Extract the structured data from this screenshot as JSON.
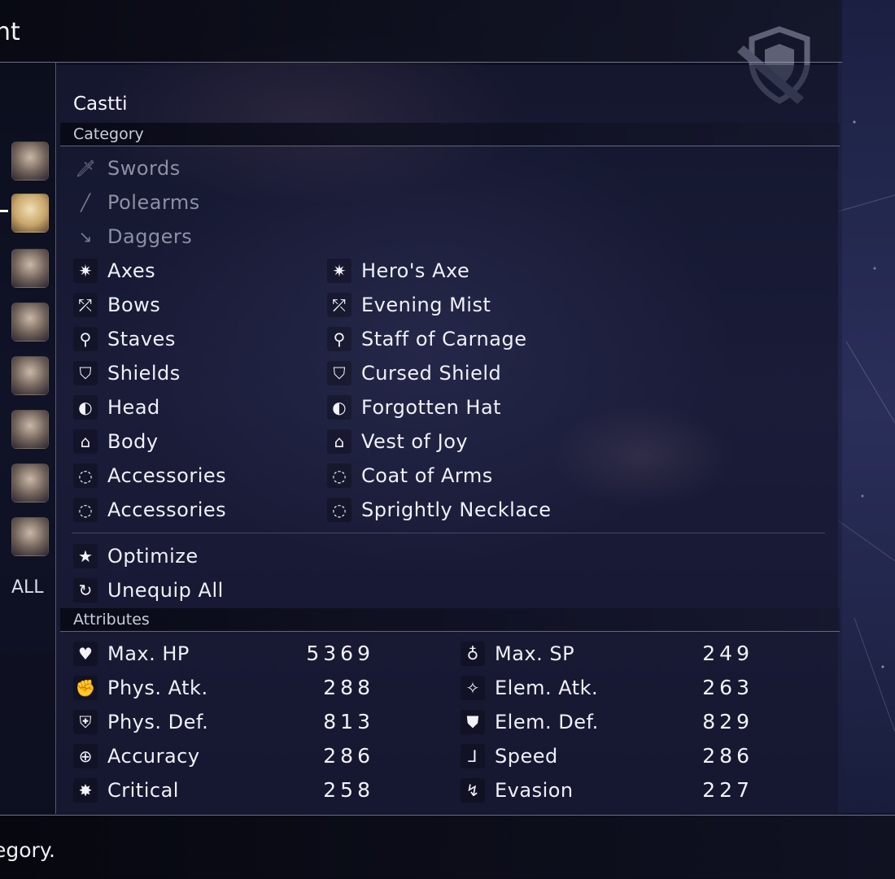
{
  "screen": {
    "title": "nt"
  },
  "character": {
    "name": "Castti"
  },
  "sidebar": {
    "portraits": [
      "p1",
      "p2",
      "p3",
      "p4",
      "p5",
      "p6",
      "p7",
      "p8"
    ],
    "all_label": "ALL"
  },
  "sections": {
    "category": "Category",
    "attributes": "Attributes"
  },
  "categories": [
    {
      "label": "Swords",
      "icon": "sword-icon",
      "equipped": ""
    },
    {
      "label": "Polearms",
      "icon": "polearm-icon",
      "equipped": ""
    },
    {
      "label": "Daggers",
      "icon": "dagger-icon",
      "equipped": ""
    },
    {
      "label": "Axes",
      "icon": "axe-icon",
      "equipped": "Hero's Axe"
    },
    {
      "label": "Bows",
      "icon": "bow-icon",
      "equipped": "Evening Mist"
    },
    {
      "label": "Staves",
      "icon": "staff-icon",
      "equipped": "Staff of Carnage"
    },
    {
      "label": "Shields",
      "icon": "shield-icon",
      "equipped": "Cursed Shield"
    },
    {
      "label": "Head",
      "icon": "helmet-icon",
      "equipped": "Forgotten Hat"
    },
    {
      "label": "Body",
      "icon": "armor-icon",
      "equipped": "Vest of Joy"
    },
    {
      "label": "Accessories",
      "icon": "necklace-icon",
      "equipped": "Coat of Arms"
    },
    {
      "label": "Accessories",
      "icon": "necklace-icon",
      "equipped": "Sprightly Necklace"
    }
  ],
  "actions": {
    "optimize": "Optimize",
    "unequip_all": "Unequip All"
  },
  "attributes": {
    "left": [
      {
        "label": "Max. HP",
        "value": "5369",
        "icon": "heart-icon"
      },
      {
        "label": "Phys. Atk.",
        "value": "288",
        "icon": "fist-icon"
      },
      {
        "label": "Phys. Def.",
        "value": "813",
        "icon": "shield-hand-icon"
      },
      {
        "label": "Accuracy",
        "value": "286",
        "icon": "crosshair-icon"
      },
      {
        "label": "Critical",
        "value": "258",
        "icon": "burst-icon"
      }
    ],
    "right": [
      {
        "label": "Max. SP",
        "value": "249",
        "icon": "spirit-icon"
      },
      {
        "label": "Elem. Atk.",
        "value": "263",
        "icon": "sparkle-hand-icon"
      },
      {
        "label": "Elem. Def.",
        "value": "829",
        "icon": "elem-shield-icon"
      },
      {
        "label": "Speed",
        "value": "286",
        "icon": "boot-icon"
      },
      {
        "label": "Evasion",
        "value": "227",
        "icon": "swirl-icon"
      }
    ]
  },
  "help_text": "egory."
}
